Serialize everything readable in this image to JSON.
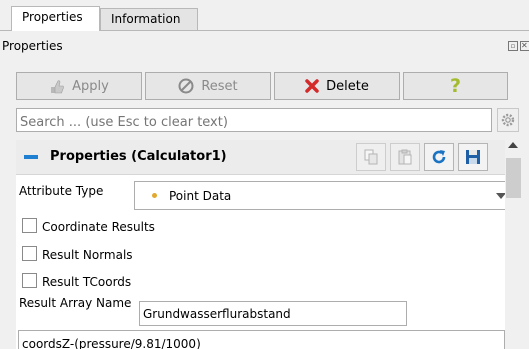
{
  "tabs": [
    {
      "label": "Properties",
      "active": true
    },
    {
      "label": "Information",
      "active": false
    }
  ],
  "dock": {
    "title": "Properties"
  },
  "toolbar": {
    "apply_label": "Apply",
    "reset_label": "Reset",
    "delete_label": "Delete",
    "help_label": "?"
  },
  "search": {
    "placeholder": "Search ... (use Esc to clear text)"
  },
  "section": {
    "title": "Properties (Calculator1)"
  },
  "attribute_type": {
    "label": "Attribute Type",
    "value": "Point Data"
  },
  "checkboxes": [
    {
      "label": "Coordinate Results",
      "checked": false
    },
    {
      "label": "Result Normals",
      "checked": false
    },
    {
      "label": "Result TCoords",
      "checked": false
    }
  ],
  "result_array": {
    "label": "Result Array Name",
    "value": "Grundwasserflurabstand"
  },
  "expression": {
    "value": "coordsZ-(pressure/9.81/1000)"
  },
  "colors": {
    "accent": "#1f7fd0",
    "delete": "#d42a2a",
    "help": "#a3bb2e",
    "point_data_dot": "#e2a930"
  }
}
